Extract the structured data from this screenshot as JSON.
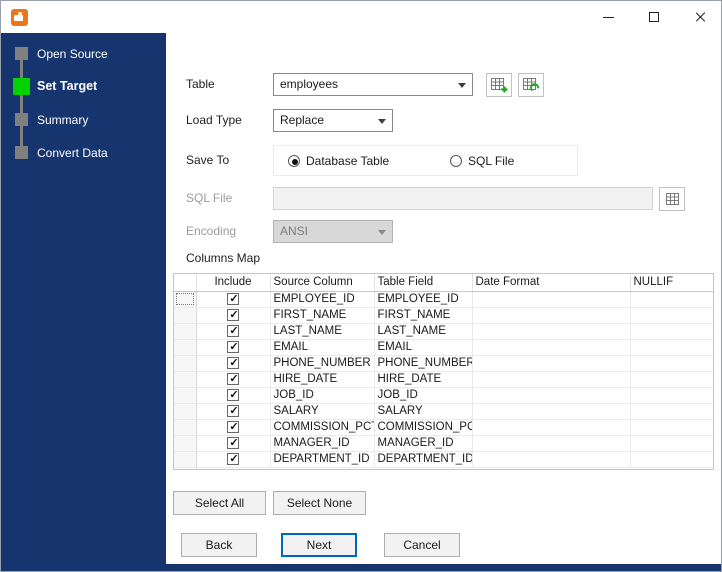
{
  "colors": {
    "sidebar": "#16356f",
    "step_active": "#00d300",
    "step_inactive": "#808080",
    "accent": "#0067c0"
  },
  "sidebar": {
    "steps": [
      {
        "label": "Open Source",
        "state": "inactive"
      },
      {
        "label": "Set Target",
        "state": "active"
      },
      {
        "label": "Summary",
        "state": "inactive"
      },
      {
        "label": "Convert Data",
        "state": "inactive"
      }
    ]
  },
  "form": {
    "table": {
      "label": "Table",
      "value": "employees"
    },
    "load_type": {
      "label": "Load Type",
      "value": "Replace"
    },
    "save_to": {
      "label": "Save To",
      "options": [
        {
          "label": "Database Table",
          "selected": true
        },
        {
          "label": "SQL File",
          "selected": false
        }
      ]
    },
    "sql_file": {
      "label": "SQL File",
      "value": "",
      "enabled": false
    },
    "encoding": {
      "label": "Encoding",
      "value": "ANSI",
      "enabled": false
    },
    "columns_map_label": "Columns Map"
  },
  "grid": {
    "headers": [
      "Include",
      "Source Column",
      "Table Field",
      "Date Format",
      "NULLIF"
    ],
    "rows": [
      {
        "include": true,
        "source_column": "EMPLOYEE_ID",
        "table_field": "EMPLOYEE_ID",
        "date_format": "",
        "nullif": ""
      },
      {
        "include": true,
        "source_column": "FIRST_NAME",
        "table_field": "FIRST_NAME",
        "date_format": "",
        "nullif": ""
      },
      {
        "include": true,
        "source_column": "LAST_NAME",
        "table_field": "LAST_NAME",
        "date_format": "",
        "nullif": ""
      },
      {
        "include": true,
        "source_column": "EMAIL",
        "table_field": "EMAIL",
        "date_format": "",
        "nullif": ""
      },
      {
        "include": true,
        "source_column": "PHONE_NUMBER",
        "table_field": "PHONE_NUMBER",
        "date_format": "",
        "nullif": ""
      },
      {
        "include": true,
        "source_column": "HIRE_DATE",
        "table_field": "HIRE_DATE",
        "date_format": "",
        "nullif": ""
      },
      {
        "include": true,
        "source_column": "JOB_ID",
        "table_field": "JOB_ID",
        "date_format": "",
        "nullif": ""
      },
      {
        "include": true,
        "source_column": "SALARY",
        "table_field": "SALARY",
        "date_format": "",
        "nullif": ""
      },
      {
        "include": true,
        "source_column": "COMMISSION_PCT",
        "table_field": "COMMISSION_PC",
        "date_format": "",
        "nullif": ""
      },
      {
        "include": true,
        "source_column": "MANAGER_ID",
        "table_field": "MANAGER_ID",
        "date_format": "",
        "nullif": ""
      },
      {
        "include": true,
        "source_column": "DEPARTMENT_ID",
        "table_field": "DEPARTMENT_ID",
        "date_format": "",
        "nullif": ""
      }
    ]
  },
  "buttons": {
    "select_all": "Select All",
    "select_none": "Select None",
    "back": "Back",
    "next": "Next",
    "cancel": "Cancel"
  }
}
